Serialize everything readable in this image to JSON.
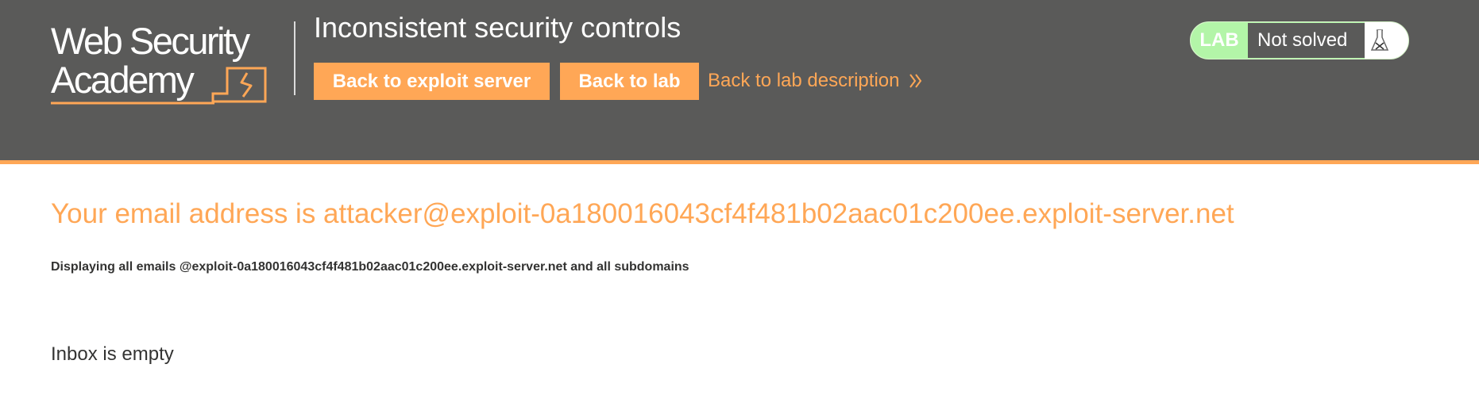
{
  "brand": {
    "logo_line1": "Web Security",
    "logo_line2": "Academy",
    "accent_color": "#ffa756",
    "header_bg": "#5a5a59"
  },
  "header": {
    "lab_title": "Inconsistent security controls",
    "buttons": {
      "exploit_server": "Back to exploit server",
      "back_to_lab": "Back to lab"
    },
    "description_link": "Back to lab description",
    "description_icon": "double-chevron-right-icon"
  },
  "lab_status": {
    "badge": "LAB",
    "state": "Not solved",
    "badge_color": "#b3f5a8",
    "icon": "flask-icon"
  },
  "main": {
    "email_heading": "Your email address is attacker@exploit-0a180016043cf4f481b02aac01c200ee.exploit-server.net",
    "display_note": "Displaying all emails @exploit-0a180016043cf4f481b02aac01c200ee.exploit-server.net and all subdomains",
    "inbox_status": "Inbox is empty"
  }
}
